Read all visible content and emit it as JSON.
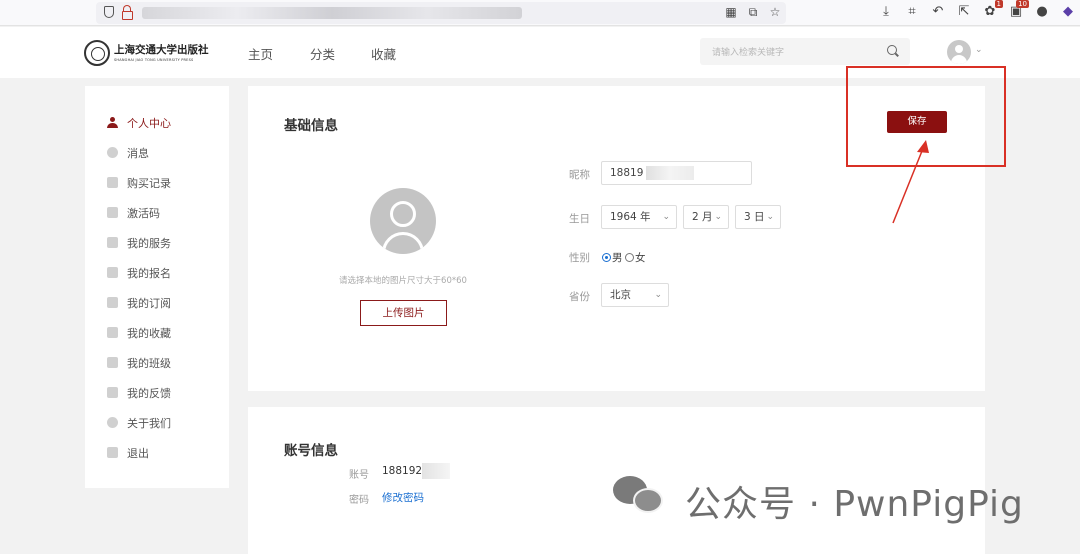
{
  "site": {
    "logo_name": "上海交通大学出版社",
    "logo_subtitle": "SHANGHAI JIAO TONG UNIVERSITY PRESS",
    "nav": [
      "主页",
      "分类",
      "收藏"
    ],
    "search_placeholder": "请输入检索关键字"
  },
  "sidebar": {
    "items": [
      {
        "label": "个人中心",
        "icon": "user-icon",
        "active": true
      },
      {
        "label": "消息",
        "icon": "message-icon"
      },
      {
        "label": "购买记录",
        "icon": "cart-icon"
      },
      {
        "label": "激活码",
        "icon": "key-icon"
      },
      {
        "label": "我的服务",
        "icon": "document-icon"
      },
      {
        "label": "我的报名",
        "icon": "document-icon"
      },
      {
        "label": "我的订阅",
        "icon": "list-icon"
      },
      {
        "label": "我的收藏",
        "icon": "document-icon"
      },
      {
        "label": "我的班级",
        "icon": "document-icon"
      },
      {
        "label": "我的反馈",
        "icon": "document-icon"
      },
      {
        "label": "关于我们",
        "icon": "gear-icon"
      },
      {
        "label": "退出",
        "icon": "logout-icon"
      }
    ]
  },
  "basic": {
    "title": "基础信息",
    "save_label": "保存",
    "upload_hint": "请选择本地的图片尺寸大于60*60",
    "upload_label": "上传图片",
    "nickname_label": "昵称",
    "nickname_value": "18819",
    "birthday_label": "生日",
    "year": "1964 年",
    "month": "2 月",
    "day": "3 日",
    "gender_label": "性别",
    "gender_male": "男",
    "gender_female": "女",
    "gender_selected": "男",
    "province_label": "省份",
    "province_value": "北京"
  },
  "account": {
    "title": "账号信息",
    "account_label": "账号",
    "account_value": "188192",
    "password_label": "密码",
    "password_link": "修改密码"
  },
  "watermark": {
    "text": "公众号 · PwnPigPig"
  },
  "colors": {
    "accent": "#8b1010",
    "annotation": "#d93025",
    "link": "#1a6fd1"
  }
}
